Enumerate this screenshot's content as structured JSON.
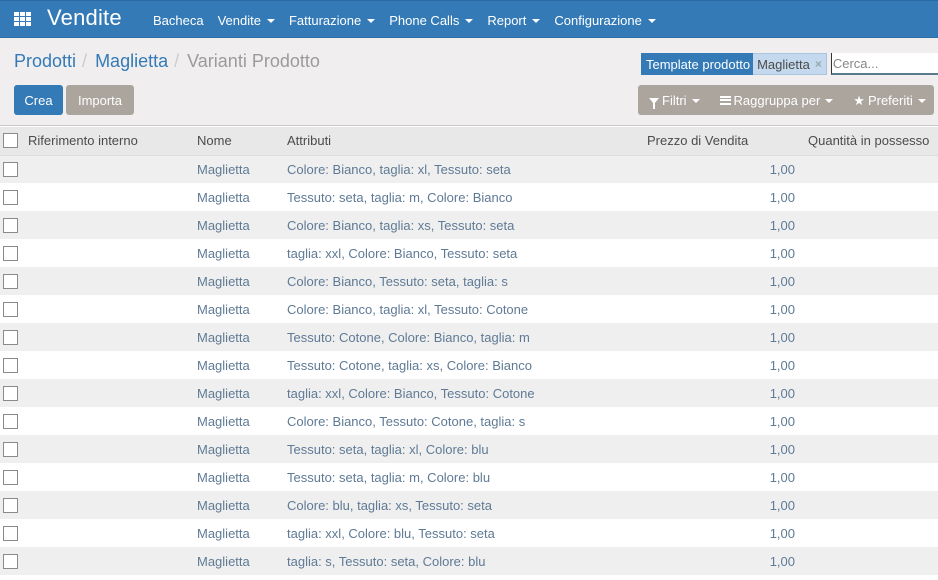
{
  "navbar": {
    "apps_icon": "apps-grid-icon",
    "brand": "Vendite",
    "menu": [
      {
        "label": "Bacheca",
        "dropdown": false
      },
      {
        "label": "Vendite",
        "dropdown": true
      },
      {
        "label": "Fatturazione",
        "dropdown": true
      },
      {
        "label": "Phone Calls",
        "dropdown": true
      },
      {
        "label": "Report",
        "dropdown": true
      },
      {
        "label": "Configurazione",
        "dropdown": true
      }
    ]
  },
  "breadcrumb": {
    "items": [
      "Prodotti",
      "Maglietta"
    ],
    "separator": "/",
    "current": "Varianti Prodotto"
  },
  "buttons": {
    "create": "Crea",
    "import": "Importa"
  },
  "search": {
    "facet_label": "Template prodotto",
    "facet_value": "Maglietta",
    "facet_remove": "×",
    "placeholder": "Cerca...",
    "value": ""
  },
  "search_options": {
    "filters": "Filtri",
    "group_by": "Raggruppa per",
    "favorites": "Preferiti"
  },
  "colors": {
    "primary": "#337ab7",
    "secondary": "#aba59e",
    "panel_bg": "#f0eeee",
    "row_alt": "#efefef",
    "link": "#5f7a95"
  },
  "table": {
    "columns": [
      "Riferimento interno",
      "Nome",
      "Attributi",
      "Prezzo di Vendita",
      "Quantità in possesso"
    ],
    "rows": [
      {
        "ref": "",
        "name": "Maglietta",
        "attributes": "Colore: Bianco, taglia: xl, Tessuto: seta",
        "price": "1,00",
        "qty": ""
      },
      {
        "ref": "",
        "name": "Maglietta",
        "attributes": "Tessuto: seta, taglia: m, Colore: Bianco",
        "price": "1,00",
        "qty": ""
      },
      {
        "ref": "",
        "name": "Maglietta",
        "attributes": "Colore: Bianco, taglia: xs, Tessuto: seta",
        "price": "1,00",
        "qty": ""
      },
      {
        "ref": "",
        "name": "Maglietta",
        "attributes": "taglia: xxl, Colore: Bianco, Tessuto: seta",
        "price": "1,00",
        "qty": ""
      },
      {
        "ref": "",
        "name": "Maglietta",
        "attributes": "Colore: Bianco, Tessuto: seta, taglia: s",
        "price": "1,00",
        "qty": ""
      },
      {
        "ref": "",
        "name": "Maglietta",
        "attributes": "Colore: Bianco, taglia: xl, Tessuto: Cotone",
        "price": "1,00",
        "qty": ""
      },
      {
        "ref": "",
        "name": "Maglietta",
        "attributes": "Tessuto: Cotone, Colore: Bianco, taglia: m",
        "price": "1,00",
        "qty": ""
      },
      {
        "ref": "",
        "name": "Maglietta",
        "attributes": "Tessuto: Cotone, taglia: xs, Colore: Bianco",
        "price": "1,00",
        "qty": ""
      },
      {
        "ref": "",
        "name": "Maglietta",
        "attributes": "taglia: xxl, Colore: Bianco, Tessuto: Cotone",
        "price": "1,00",
        "qty": ""
      },
      {
        "ref": "",
        "name": "Maglietta",
        "attributes": "Colore: Bianco, Tessuto: Cotone, taglia: s",
        "price": "1,00",
        "qty": ""
      },
      {
        "ref": "",
        "name": "Maglietta",
        "attributes": "Tessuto: seta, taglia: xl, Colore: blu",
        "price": "1,00",
        "qty": ""
      },
      {
        "ref": "",
        "name": "Maglietta",
        "attributes": "Tessuto: seta, taglia: m, Colore: blu",
        "price": "1,00",
        "qty": ""
      },
      {
        "ref": "",
        "name": "Maglietta",
        "attributes": "Colore: blu, taglia: xs, Tessuto: seta",
        "price": "1,00",
        "qty": ""
      },
      {
        "ref": "",
        "name": "Maglietta",
        "attributes": "taglia: xxl, Colore: blu, Tessuto: seta",
        "price": "1,00",
        "qty": ""
      },
      {
        "ref": "",
        "name": "Maglietta",
        "attributes": "taglia: s, Tessuto: seta, Colore: blu",
        "price": "1,00",
        "qty": ""
      }
    ]
  }
}
